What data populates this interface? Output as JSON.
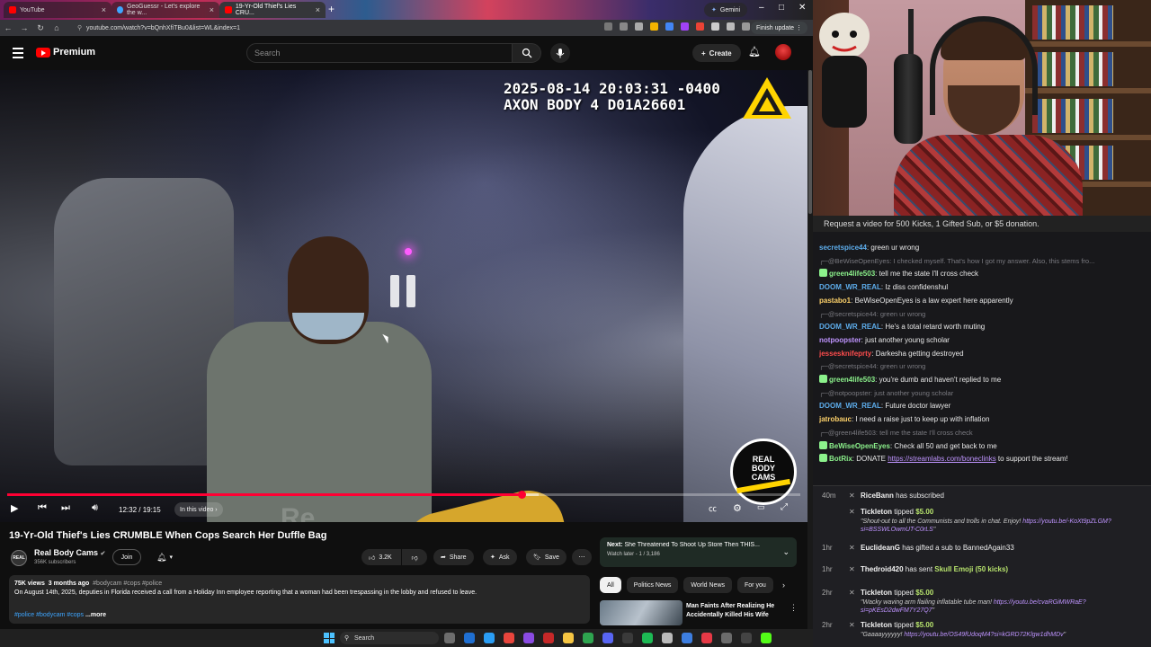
{
  "browser": {
    "tabs": [
      {
        "title": "YouTube",
        "active": false
      },
      {
        "title": "GeoGuessr - Let's explore the w...",
        "active": false
      },
      {
        "title": "19-Yr-Old Thief's Lies CRU...",
        "active": true
      }
    ],
    "gemini_label": "Gemini",
    "url": "youtube.com/watch?v=bQnhXfiTBu0&list=WL&index=1",
    "finish_update": "Finish update"
  },
  "youtube": {
    "logo_text": "Premium",
    "search_placeholder": "Search",
    "create_label": "Create",
    "video": {
      "osd_line1": "2025-08-14 20:03:31 -0400",
      "osd_line2": "AXON BODY 4 D01A26601",
      "watermark": "Re...",
      "badge_line1": "REAL",
      "badge_line2": "BODY",
      "badge_line3": "CAMS",
      "progress_fraction": 0.648,
      "buffered_fraction": 0.67,
      "time": "12:32 / 19:15",
      "in_this_video": "In this video"
    },
    "title": "19-Yr-Old Thief's Lies CRUMBLE When Cops Search Her Duffle Bag",
    "channel": {
      "avatar_text": "REAL",
      "name": "Real Body Cams",
      "subs": "356K subscribers",
      "join": "Join"
    },
    "actions": {
      "likes": "3.2K",
      "share": "Share",
      "ask": "Ask",
      "save": "Save"
    },
    "description": {
      "views": "75K views",
      "ago": "3 months ago",
      "hashtags": "#bodycam #cops #police",
      "text": "On August 14th, 2025, deputies in Florida received a call from a Holiday Inn employee reporting that a woman had been trespassing in the lobby and refused to leave.",
      "tags_bottom": "#police #bodycam #cops",
      "more": "...more"
    },
    "next": {
      "prefix": "Next:",
      "title": "She Threatened To Shoot Up Store Then THIS...",
      "sub": "Watch later - 1 / 3,186"
    },
    "chips": [
      "All",
      "Politics News",
      "World News",
      "For you"
    ],
    "rec_title": "Man Faints After Realizing He Accidentally Killed His Wife"
  },
  "taskbar": {
    "search": "Search"
  },
  "stream": {
    "chat_header": "Request a video for 500 Kicks, 1 Gifted Sub, or $5 donation.",
    "messages": [
      {
        "type": "msg",
        "user": "secretspice44",
        "color": "#5dadec",
        "text": "green ur wrong"
      },
      {
        "type": "reply",
        "text": "@BeWiseOpenEyes: I checked myself. That's how I got my answer. Also, this stems fro..."
      },
      {
        "type": "msg",
        "user": "green4life503",
        "color": "#8cf28c",
        "text": "tell me the state I'll cross check",
        "badge": true
      },
      {
        "type": "msg",
        "user": "DOOM_WR_REAL",
        "color": "#5dadec",
        "text": "Iz diss confidenshul"
      },
      {
        "type": "msg",
        "user": "pastabo1",
        "color": "#ffd36b",
        "text": "BeWiseOpenEyes is a law expert here apparently"
      },
      {
        "type": "reply",
        "text": "@secretspice44: green ur wrong"
      },
      {
        "type": "msg",
        "user": "DOOM_WR_REAL",
        "color": "#5dadec",
        "text": "He's a total retard worth muting"
      },
      {
        "type": "msg",
        "user": "notpoopster",
        "color": "#bf94ff",
        "text": "just another young scholar"
      },
      {
        "type": "msg",
        "user": "jessesknifeprty",
        "color": "#ff4d4d",
        "text": "Darkesha getting destroyed"
      },
      {
        "type": "reply",
        "text": "@secretspice44: green ur wrong"
      },
      {
        "type": "msg",
        "user": "green4life503",
        "color": "#8cf28c",
        "text": "you're dumb and haven't replied to me",
        "badge": true
      },
      {
        "type": "reply",
        "text": "@notpoopster: just another young scholar"
      },
      {
        "type": "msg",
        "user": "DOOM_WR_REAL",
        "color": "#5dadec",
        "text": "Future doctor lawyer"
      },
      {
        "type": "msg",
        "user": "jatrobauc",
        "color": "#ffd36b",
        "text": "I need a raise just to keep up with inflation"
      },
      {
        "type": "reply",
        "text": "@green4life503: tell me the state I'll cross check"
      },
      {
        "type": "msg",
        "user": "BeWiseOpenEyes",
        "color": "#8cf28c",
        "text": "Check all 50 and get back to me",
        "badge": true
      },
      {
        "type": "msg",
        "user": "BotRix",
        "color": "#8cf28c",
        "text": "DONATE ",
        "link": "https://streamlabs.com/boneclinks",
        "after": " to support the stream!",
        "badge": true
      }
    ],
    "events": [
      {
        "time": "40m",
        "name": "RiceBann",
        "text": " has subscribed"
      },
      {
        "time": "",
        "name": "Tickleton",
        "text": " tipped ",
        "amount": "$5.00",
        "quote": "\"Shout-out to all the Communists and trolls in chat. Enjoy! ",
        "qlink": "https://youtu.be/-KoXt9pZLGM?si=BSSWLOwmUT-C0rLS",
        "qend": "\""
      },
      {
        "time": "1hr",
        "name": "EuclideanG",
        "text": " has gifted a sub to BannedAgain33"
      },
      {
        "time": "1hr",
        "name": "Thedroid420",
        "text": " has sent ",
        "gift": "Skull Emoji (50 kicks)"
      },
      {
        "time": "2hr",
        "name": "Tickleton",
        "text": " tipped ",
        "amount": "$5.00",
        "quote": "\"Wacky waving arm flailing inflatable tube man! ",
        "qlink": "https://youtu.be/cvaRGiMWRaE?si=pKEsD2dwFM7Y27Q7",
        "qend": "\""
      },
      {
        "time": "2hr",
        "name": "Tickleton",
        "text": " tipped ",
        "amount": "$5.00",
        "quote": "\"Gaaaayyyyyy! ",
        "qlink": "https://youtu.be/OS49fUdoqM4?si=kGRD72Klgw1dhMDv",
        "qend": "\""
      }
    ]
  }
}
